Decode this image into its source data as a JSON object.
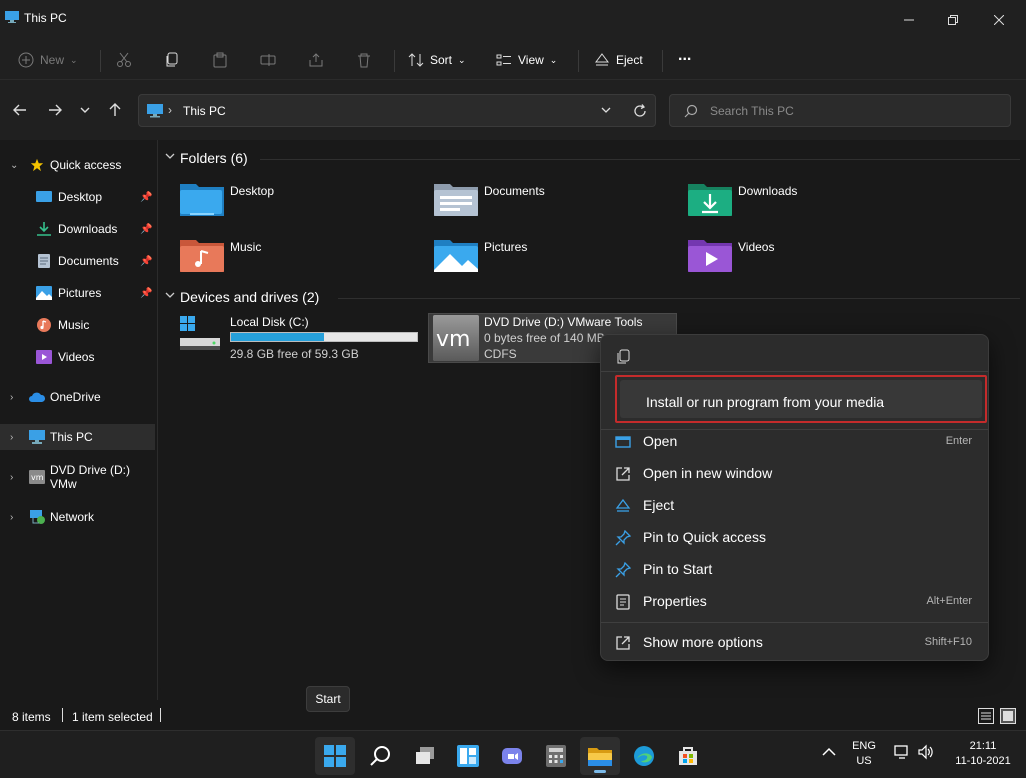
{
  "window": {
    "title": "This PC"
  },
  "commandbar": {
    "new_label": "New",
    "sort_label": "Sort",
    "view_label": "View",
    "eject_label": "Eject",
    "more_label": "..."
  },
  "address": {
    "path": "This PC",
    "search_placeholder": "Search This PC"
  },
  "sidebar": {
    "items": [
      {
        "label": "Quick access"
      },
      {
        "label": "Desktop"
      },
      {
        "label": "Downloads"
      },
      {
        "label": "Documents"
      },
      {
        "label": "Pictures"
      },
      {
        "label": "Music"
      },
      {
        "label": "Videos"
      },
      {
        "label": "OneDrive"
      },
      {
        "label": "This PC"
      },
      {
        "label": "DVD Drive (D:) VMw"
      },
      {
        "label": "Network"
      }
    ]
  },
  "content": {
    "folders_heading": "Folders (6)",
    "folders": [
      {
        "label": "Desktop"
      },
      {
        "label": "Documents"
      },
      {
        "label": "Downloads"
      },
      {
        "label": "Music"
      },
      {
        "label": "Pictures"
      },
      {
        "label": "Videos"
      }
    ],
    "drives_heading": "Devices and drives (2)",
    "drives": [
      {
        "name": "Local Disk (C:)",
        "free": "29.8 GB free of 59.3 GB",
        "used_fraction": 0.5
      },
      {
        "name": "DVD Drive (D:) VMware Tools",
        "free": "0 bytes free of 140 MB",
        "fs": "CDFS",
        "logo": "vm"
      }
    ]
  },
  "status": {
    "items": "8 items",
    "selected": "1 item selected"
  },
  "context_menu": {
    "highlighted": "Install or run program from your media",
    "items": [
      {
        "label": "Open",
        "shortcut": "Enter"
      },
      {
        "label": "Open in new window",
        "shortcut": ""
      },
      {
        "label": "Eject",
        "shortcut": ""
      },
      {
        "label": "Pin to Quick access",
        "shortcut": ""
      },
      {
        "label": "Pin to Start",
        "shortcut": ""
      },
      {
        "label": "Properties",
        "shortcut": "Alt+Enter"
      },
      {
        "label": "Show more options",
        "shortcut": "Shift+F10"
      }
    ]
  },
  "tooltip": {
    "text": "Start"
  },
  "taskbar": {
    "lang_top": "ENG",
    "lang_bottom": "US",
    "time": "21:11",
    "date": "11-10-2021"
  },
  "colors": {
    "accent": "#26a0da",
    "highlight_border": "#c42b2b",
    "background": "#191919"
  }
}
